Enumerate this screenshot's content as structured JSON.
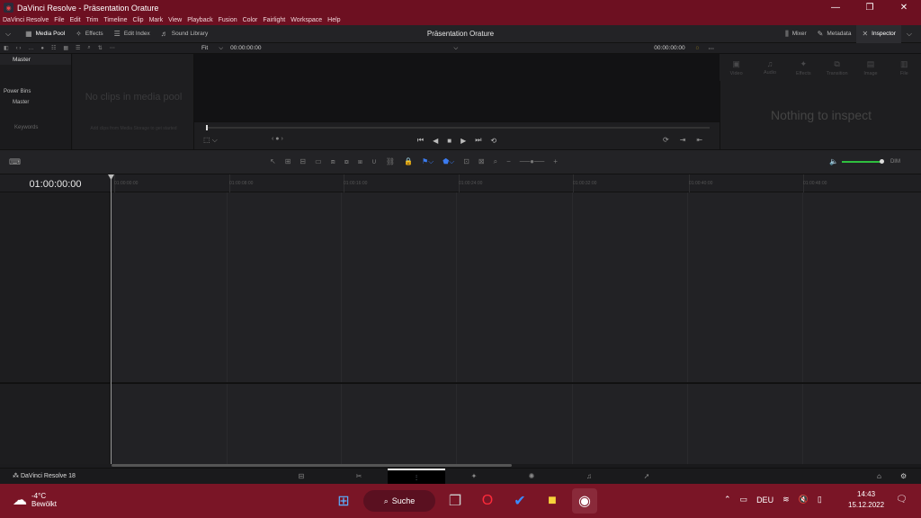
{
  "window": {
    "title": "DaVinci Resolve - Präsentation Orature",
    "controls": [
      "—",
      "❐",
      "✕"
    ]
  },
  "menu": [
    "DaVinci Resolve",
    "File",
    "Edit",
    "Trim",
    "Timeline",
    "Clip",
    "Mark",
    "View",
    "Playback",
    "Fusion",
    "Color",
    "Fairlight",
    "Workspace",
    "Help"
  ],
  "toolbar": {
    "media_pool": "Media Pool",
    "effects": "Effects",
    "edit_index": "Edit Index",
    "sound_library": "Sound Library",
    "project_title": "Präsentation Orature",
    "mixer": "Mixer",
    "metadata": "Metadata",
    "inspector": "Inspector"
  },
  "bins": {
    "master": "Master",
    "power_bins": "Power Bins",
    "power_master": "Master",
    "keywords": "Keywords"
  },
  "pool": {
    "empty": "No clips in media pool",
    "hint": "Add clips from Media Storage to get started"
  },
  "viewer": {
    "fit": "Fit",
    "timecode_left": "00:00:00:00",
    "timecode_right": "00:00:00:00"
  },
  "inspector": {
    "tabs": [
      {
        "icon": "▣",
        "label": "Video"
      },
      {
        "icon": "♫",
        "label": "Audio"
      },
      {
        "icon": "✦",
        "label": "Effects"
      },
      {
        "icon": "⧉",
        "label": "Transition"
      },
      {
        "icon": "▤",
        "label": "Image"
      },
      {
        "icon": "▥",
        "label": "File"
      }
    ],
    "empty": "Nothing to inspect"
  },
  "timeline": {
    "timecode": "01:00:00:00",
    "ruler": [
      "01:00:00:00",
      "01:00:08:00",
      "01:00:16:00",
      "01:00:24:00",
      "01:00:32:00",
      "01:00:40:00",
      "01:00:48:00"
    ],
    "dim": "DIM"
  },
  "pagebar": {
    "brand": "DaVinci Resolve 18"
  },
  "taskbar": {
    "temp": "-4°C",
    "weather": "Bewölkt",
    "search": "Suche",
    "lang": "DEU",
    "time": "14:43",
    "date": "15.12.2022"
  }
}
